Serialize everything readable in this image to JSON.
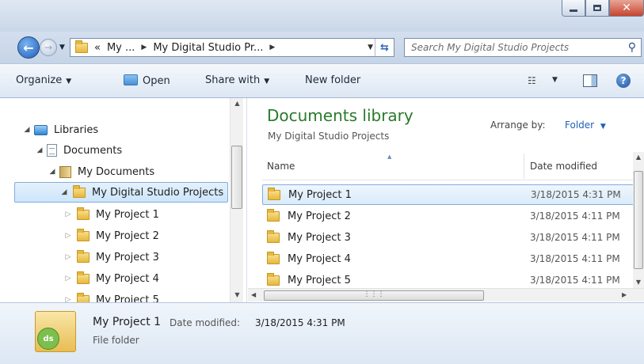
{
  "window": {
    "buttons": {
      "minimize": "minimize",
      "maximize": "maximize",
      "close": "x"
    }
  },
  "nav": {
    "back_glyph": "←",
    "forward_glyph": "→",
    "breadcrumb": {
      "overflow": "«",
      "items": [
        "My ...",
        "My Digital Studio Pr..."
      ]
    },
    "search_placeholder": "Search My Digital Studio Projects"
  },
  "toolbar": {
    "organize": "Organize",
    "open": "Open",
    "share_with": "Share with",
    "new_folder": "New folder",
    "help": "?"
  },
  "tree": {
    "libraries": "Libraries",
    "documents": "Documents",
    "my_documents": "My Documents",
    "selected": "My Digital Studio Projects",
    "children": [
      "My Project 1",
      "My Project 2",
      "My Project 3",
      "My Project 4",
      "My Project 5"
    ]
  },
  "content": {
    "title": "Documents library",
    "subtitle": "My Digital Studio Projects",
    "arrange_label": "Arrange by:",
    "arrange_value": "Folder",
    "columns": {
      "name": "Name",
      "date": "Date modified"
    },
    "files": [
      {
        "name": "My Project 1",
        "date": "3/18/2015 4:31 PM"
      },
      {
        "name": "My Project 2",
        "date": "3/18/2015 4:11 PM"
      },
      {
        "name": "My Project 3",
        "date": "3/18/2015 4:11 PM"
      },
      {
        "name": "My Project 4",
        "date": "3/18/2015 4:11 PM"
      },
      {
        "name": "My Project 5",
        "date": "3/18/2015 4:11 PM"
      }
    ]
  },
  "details": {
    "name": "My Project 1",
    "date_label": "Date modified:",
    "date": "3/18/2015 4:31 PM",
    "type": "File folder",
    "badge": "ds"
  },
  "colors": {
    "library_title": "#2a7a2a",
    "link": "#1f5fb8",
    "selection": "#cde5fb"
  }
}
